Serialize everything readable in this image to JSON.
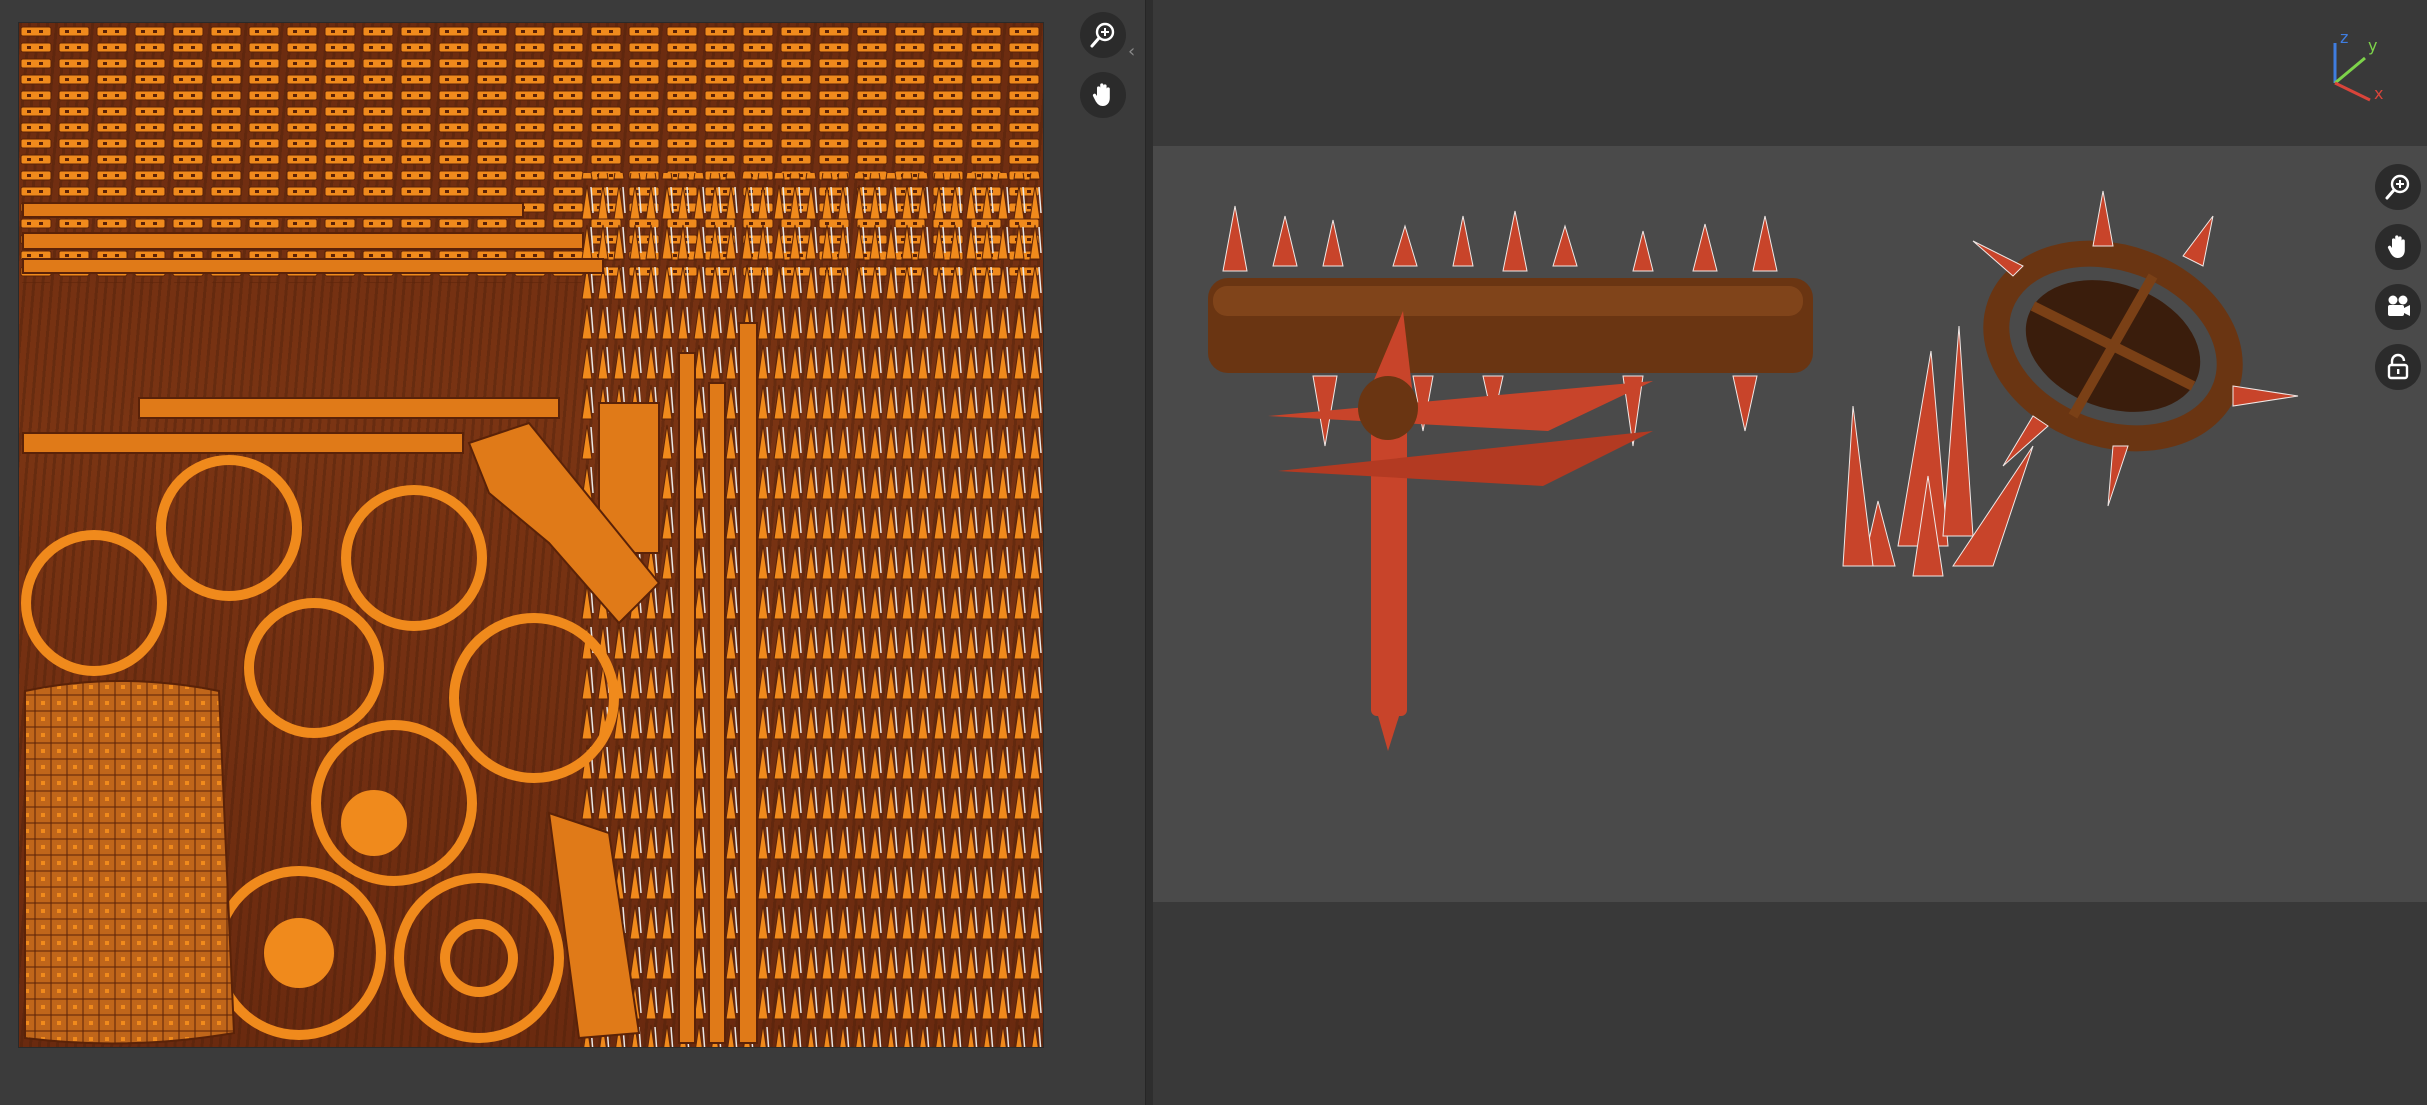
{
  "uv_editor": {
    "tools": [
      {
        "name": "zoom",
        "icon": "zoom-in-icon"
      },
      {
        "name": "pan",
        "icon": "hand-icon"
      }
    ]
  },
  "splitter": {
    "left_arrow": "‹",
    "right_arrow": "›"
  },
  "viewport": {
    "axis_gizmo": {
      "z_label": "z",
      "y_label": "y",
      "x_label": "x"
    },
    "tools": [
      {
        "name": "zoom",
        "icon": "zoom-in-icon"
      },
      {
        "name": "pan",
        "icon": "hand-icon"
      },
      {
        "name": "camera",
        "icon": "camera-icon"
      },
      {
        "name": "lock",
        "icon": "unlock-icon"
      }
    ],
    "models": [
      "spiked-log",
      "spiked-wheel",
      "cross-blade",
      "spike-cluster"
    ]
  },
  "colors": {
    "uv_orange": "#f08a1c",
    "texture_brown": "#6b2b10",
    "viewport_band": "#4a4a4a",
    "panel_bg": "#393939",
    "button_bg": "#2b2b2b",
    "axis_x": "#d9443a",
    "axis_y": "#7dd34a",
    "axis_z": "#3f7de0"
  }
}
